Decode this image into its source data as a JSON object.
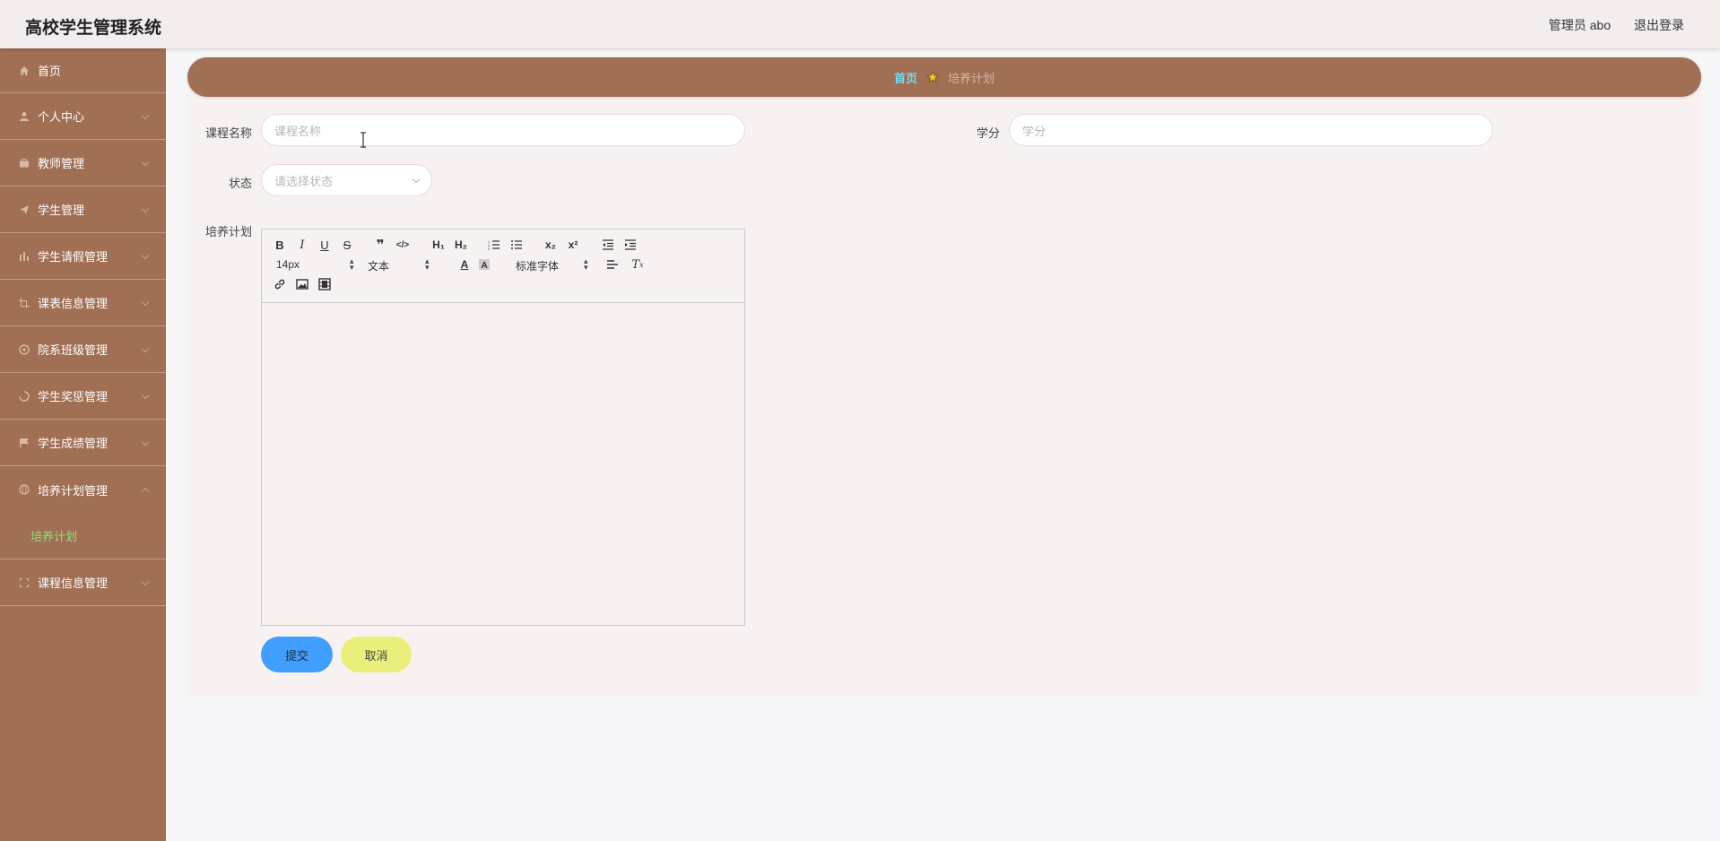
{
  "header": {
    "app_title": "高校学生管理系统",
    "user_label": "管理员 abo",
    "logout_label": "退出登录"
  },
  "sidebar": {
    "items": [
      {
        "label": "首页",
        "icon": "home-icon"
      },
      {
        "label": "个人中心",
        "icon": "user-icon"
      },
      {
        "label": "教师管理",
        "icon": "briefcase-icon"
      },
      {
        "label": "学生管理",
        "icon": "send-icon"
      },
      {
        "label": "学生请假管理",
        "icon": "chart-icon"
      },
      {
        "label": "课表信息管理",
        "icon": "crop-icon"
      },
      {
        "label": "院系班级管理",
        "icon": "target-icon"
      },
      {
        "label": "学生奖惩管理",
        "icon": "loading-icon"
      },
      {
        "label": "学生成绩管理",
        "icon": "flag-icon"
      },
      {
        "label": "培养计划管理",
        "icon": "globe-icon"
      },
      {
        "label": "课程信息管理",
        "icon": "fullscreen-icon"
      }
    ],
    "active_sub_item": "培养计划"
  },
  "breadcrumb": {
    "home": "首页",
    "current": "培养计划"
  },
  "form": {
    "course_name_label": "课程名称",
    "course_name_placeholder": "课程名称",
    "credit_label": "学分",
    "credit_placeholder": "学分",
    "status_label": "状态",
    "status_placeholder": "请选择状态",
    "plan_label": "培养计划"
  },
  "editor": {
    "font_size": "14px",
    "header_select": "文本",
    "font_family": "标准字体"
  },
  "actions": {
    "submit_label": "提交",
    "cancel_label": "取消"
  },
  "colors": {
    "sidebar_bg": "#a06f54",
    "breadcrumb_home": "#79d7ee",
    "active_sub_item": "#8ee07b",
    "submit_button": "#409eff",
    "cancel_button": "#e9ef7a"
  }
}
